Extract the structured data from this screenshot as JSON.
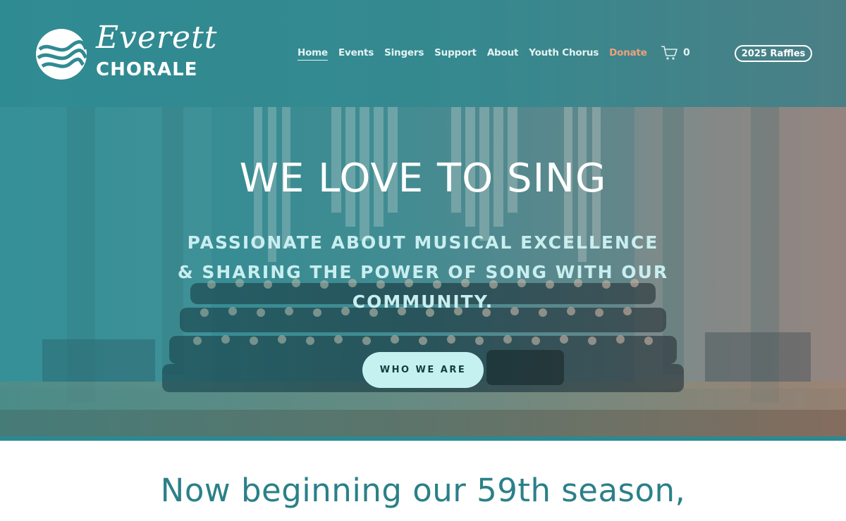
{
  "brand": {
    "script_name": "Everett",
    "word_name": "CHORALE"
  },
  "nav": {
    "items": [
      {
        "label": "Home",
        "active": true
      },
      {
        "label": "Events"
      },
      {
        "label": "Singers"
      },
      {
        "label": "Support"
      },
      {
        "label": "About"
      },
      {
        "label": "Youth Chorus"
      },
      {
        "label": "Donate",
        "accent": "#f0a17c"
      }
    ]
  },
  "cart": {
    "icon": "cart-icon",
    "count": "0"
  },
  "raffles_button": "2025 Raffles",
  "hero": {
    "title": "WE LOVE TO SING",
    "subtitle": "PASSIONATE ABOUT MUSICAL EXCELLENCE & SHARING THE POWER OF SONG WITH OUR COMMUNITY.",
    "cta": "WHO WE ARE"
  },
  "season_heading": "Now beginning our 59th season,",
  "colors": {
    "header_teal": "#2f8b92",
    "accent_donate": "#f0a17c",
    "cta_bg": "#c5f1f1",
    "heading_teal": "#2b8088"
  }
}
